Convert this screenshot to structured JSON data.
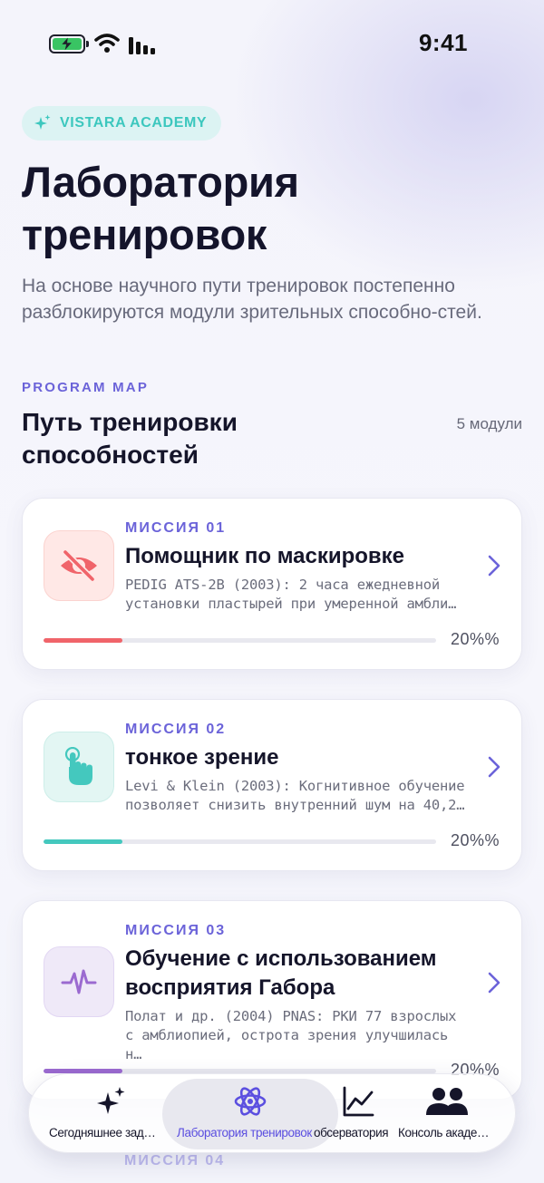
{
  "status_bar": {
    "time": "9:41"
  },
  "header": {
    "badge": "VISTARA ACADEMY",
    "title": "Лаборатория тренировок",
    "subtitle": "На основе научного пути тренировок постепенно разблокируются модули зрительных способно-стей."
  },
  "section": {
    "kicker": "PROGRAM MAP",
    "title": "Путь тренировки способностей",
    "count": "5 модули"
  },
  "missions": [
    {
      "kicker": "МИССИЯ 01",
      "title": "Помощник по маскировке",
      "desc": "PEDIG ATS-2B (2003): 2 часа ежедневной установки пластырей при умеренной амбли…",
      "icon": "eye-slash-icon",
      "accent": "#f0646a",
      "icon_bg": "#ffe8e6",
      "progress": 0.2,
      "progress_label": "20%%"
    },
    {
      "kicker": "МИССИЯ 02",
      "title": "тонкое зрение",
      "desc": "Levi & Klein (2003): Когнитивное обучение позволяет снизить внутренний шум на 40,2…",
      "icon": "tap-hand-icon",
      "accent": "#44c8be",
      "icon_bg": "#e3f6f3",
      "progress": 0.2,
      "progress_label": "20%%"
    },
    {
      "kicker": "МИССИЯ 03",
      "title": "Обучение с использованием восприятия Габора",
      "desc": "Полат и др. (2004) PNAS: РКИ 77 взрослых с амблиопией, острота зрения улучшилась н…",
      "icon": "waveform-icon",
      "accent": "#9b6ad0",
      "icon_bg": "#efe9f8",
      "progress": 0.2,
      "progress_label": "20%%"
    }
  ],
  "next_mission_kicker": "МИССИЯ 04",
  "tabs": [
    {
      "label": "Сегодняшнее задание",
      "icon": "sparkles-icon",
      "active": false
    },
    {
      "label": "Лаборатория тренировок",
      "icon": "atom-icon",
      "active": true
    },
    {
      "label": "обсерватория",
      "icon": "chart-line-icon",
      "active": false
    },
    {
      "label": "Консоль академии",
      "icon": "people-icon",
      "active": false
    }
  ],
  "colors": {
    "accent": "#5b4fe0",
    "badge_text": "#3cc7be"
  }
}
